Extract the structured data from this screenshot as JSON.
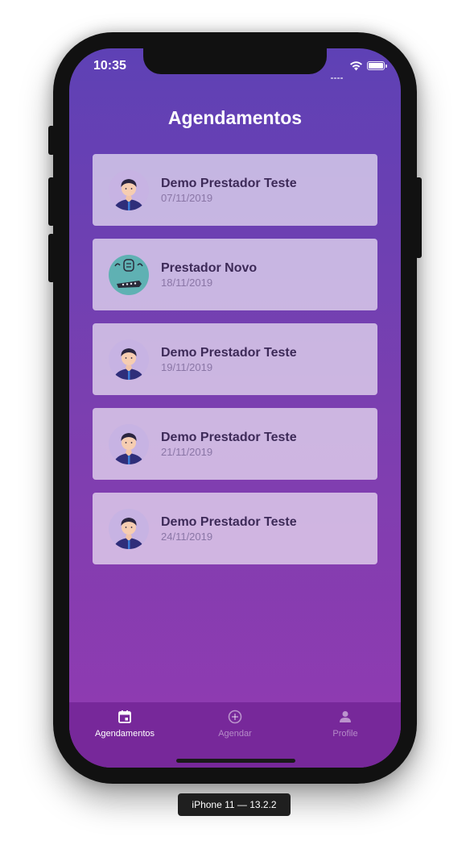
{
  "status_bar": {
    "time": "10:35"
  },
  "page": {
    "title": "Agendamentos"
  },
  "appointments": [
    {
      "name": "Demo Prestador Teste",
      "date": "07/11/2019",
      "avatar": "person-avatar"
    },
    {
      "name": "Prestador Novo",
      "date": "18/11/2019",
      "avatar": "robot-avatar"
    },
    {
      "name": "Demo Prestador Teste",
      "date": "19/11/2019",
      "avatar": "person-avatar"
    },
    {
      "name": "Demo Prestador Teste",
      "date": "21/11/2019",
      "avatar": "person-avatar"
    },
    {
      "name": "Demo Prestador Teste",
      "date": "24/11/2019",
      "avatar": "person-avatar"
    }
  ],
  "tabbar": {
    "items": [
      {
        "label": "Agendamentos",
        "icon": "calendar-icon",
        "active": true
      },
      {
        "label": "Agendar",
        "icon": "add-circle-icon",
        "active": false
      },
      {
        "label": "Profile",
        "icon": "person-icon",
        "active": false
      }
    ]
  },
  "device": {
    "label": "iPhone 11 — 13.2.2"
  },
  "colors": {
    "gradient_top": "#5e41b5",
    "gradient_bottom": "#923ab1",
    "tabbar": "#77289a",
    "card_name": "#3d2a58",
    "card_date": "#8a76a6"
  }
}
